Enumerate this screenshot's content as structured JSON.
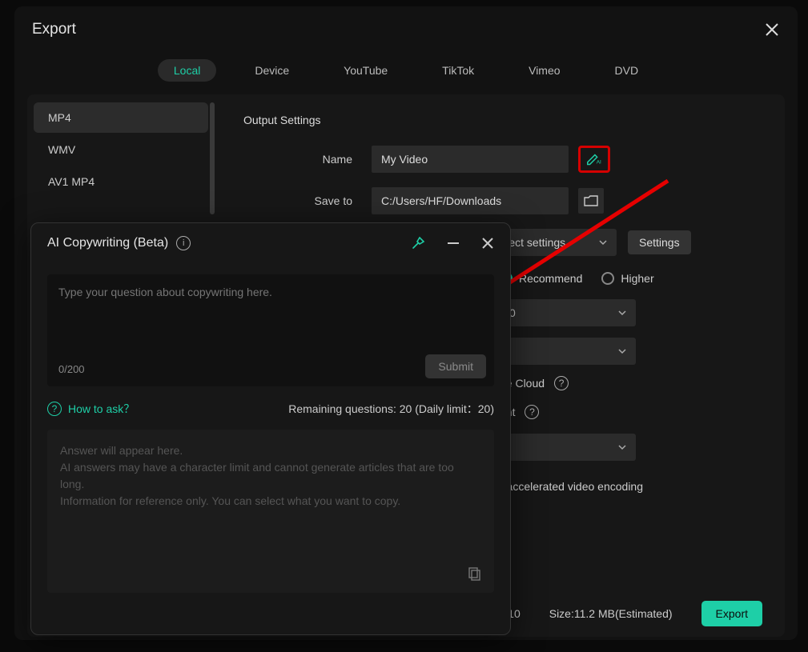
{
  "modal": {
    "title": "Export"
  },
  "tabs": [
    "Local",
    "Device",
    "YouTube",
    "TikTok",
    "Vimeo",
    "DVD"
  ],
  "activeTab": 0,
  "formats": [
    "MP4",
    "WMV",
    "AV1 MP4"
  ],
  "activeFormat": 0,
  "output": {
    "sectionTitle": "Output Settings",
    "nameLabel": "Name",
    "nameValue": "My Video",
    "saveLabel": "Save to",
    "savePath": "C:/Users/HF/Downloads",
    "presetValue": "project settings",
    "settingsLabel": "Settings",
    "recommendLabel": "Recommend",
    "higherLabel": "Higher",
    "dropdown0": "0",
    "cloudText": "he Cloud",
    "lightText": "ght",
    "encodingText": ") accelerated video encoding"
  },
  "footer": {
    "val10": "10",
    "sizeLabel": "Size:",
    "sizeValue": "11.2 MB(Estimated)",
    "exportLabel": "Export"
  },
  "ai": {
    "title": "AI Copywriting (Beta)",
    "placeholder": "Type your question about copywriting here.",
    "count": "0/200",
    "submit": "Submit",
    "howto": "How to ask？",
    "remaining": "Remaining questions: 20 (Daily limit：20)",
    "answerPlaceholder1": "Answer will appear here.",
    "answerPlaceholder2": "AI answers may have a character limit and cannot generate articles that are too long.",
    "answerPlaceholder3": "Information for reference only. You can select what you want to copy."
  }
}
